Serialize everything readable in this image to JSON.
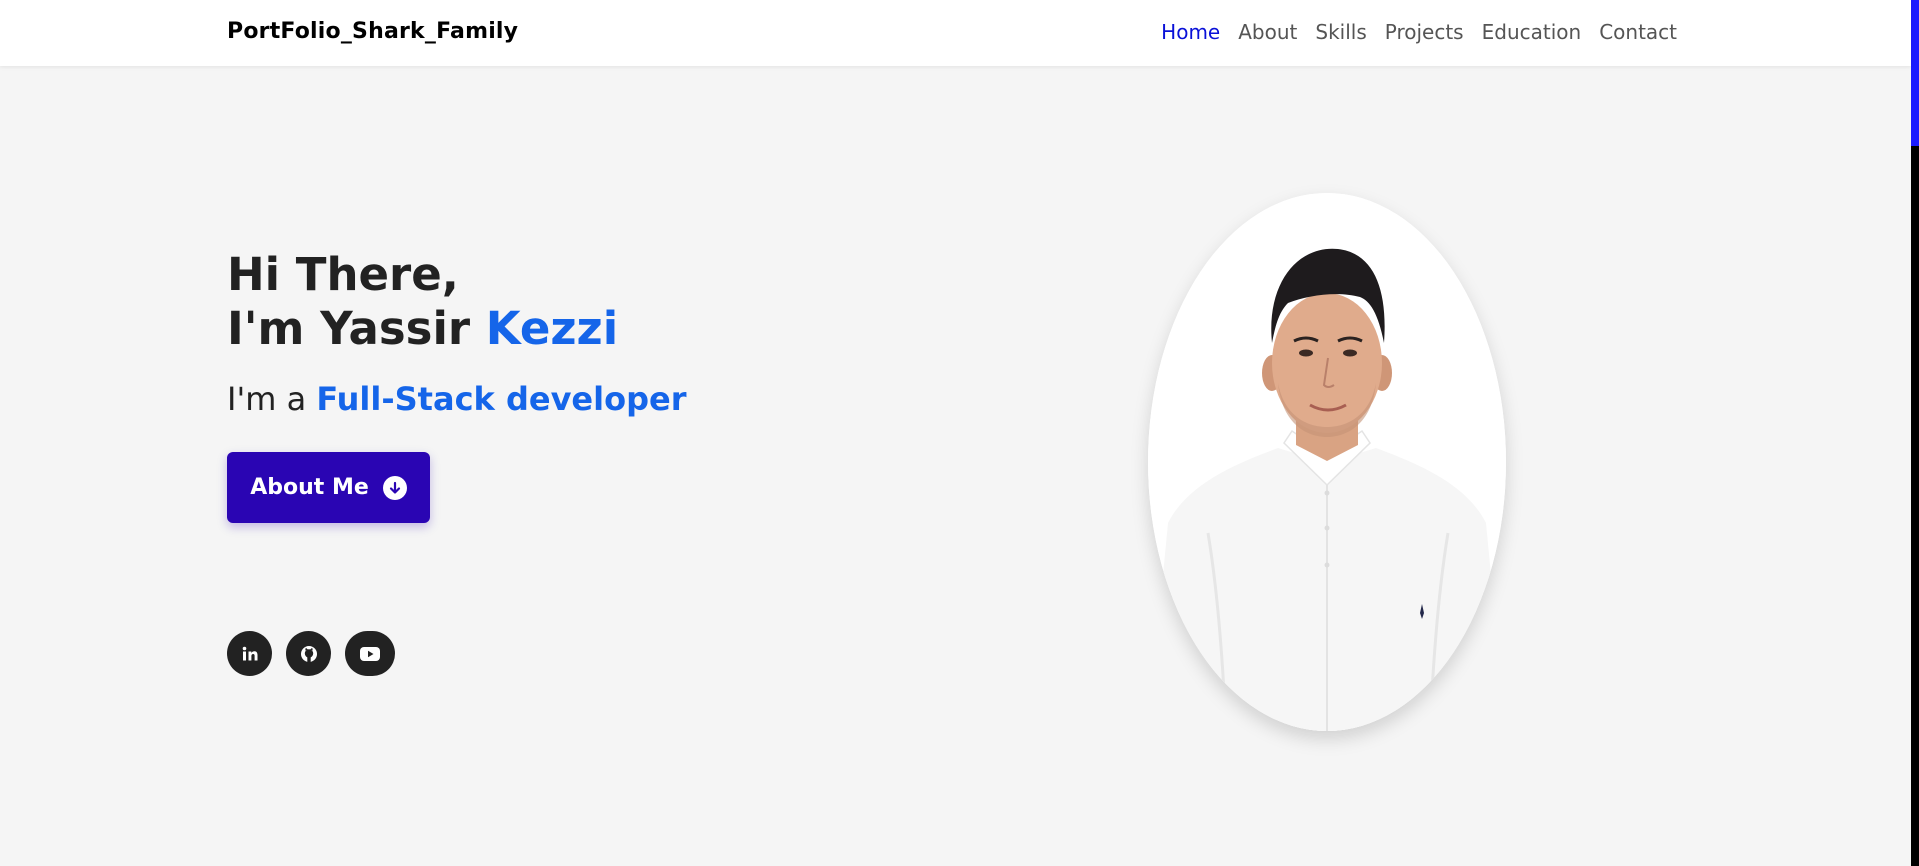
{
  "brand": "PortFolio_Shark_Family",
  "nav": {
    "items": [
      {
        "label": "Home",
        "active": true
      },
      {
        "label": "About",
        "active": false
      },
      {
        "label": "Skills",
        "active": false
      },
      {
        "label": "Projects",
        "active": false
      },
      {
        "label": "Education",
        "active": false
      },
      {
        "label": "Contact",
        "active": false
      }
    ]
  },
  "hero": {
    "line1": "Hi There,",
    "line2_prefix": "I'm Yassir ",
    "line2_accent": "Kezzi",
    "role_prefix": "I'm a ",
    "role_accent": "Full-Stack developer",
    "button_label": "About Me"
  },
  "social": [
    {
      "icon": "linkedin-icon"
    },
    {
      "icon": "github-icon"
    },
    {
      "icon": "youtube-icon"
    }
  ],
  "colors": {
    "accent": "#1565e9",
    "button": "#2a05b3",
    "nav_active": "#0a11d8",
    "scroll_thumb": "#1b1bff"
  }
}
